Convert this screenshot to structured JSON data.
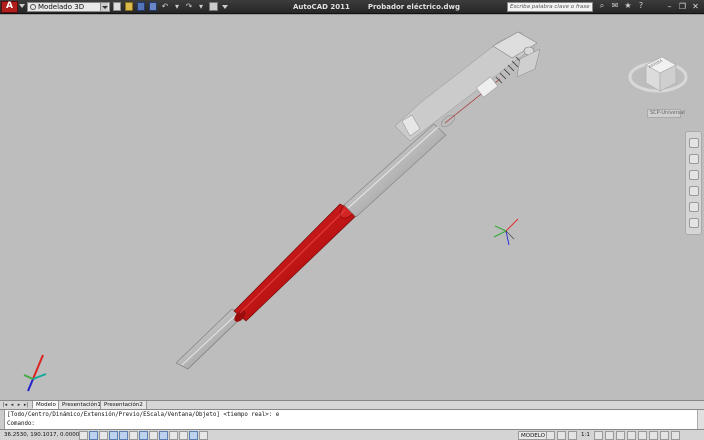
{
  "titlebar": {
    "app_button_label": "A",
    "workspace": "Modelado 3D",
    "app_name": "AutoCAD 2011",
    "document": "Probador eléctrico.dwg",
    "search_placeholder": "Escriba palabra clave o frase"
  },
  "viewcube": {
    "face_label": "ARRIBA",
    "wcs_menu": "SCP-Universal"
  },
  "tabs": [
    {
      "label": "Modelo",
      "active": true
    },
    {
      "label": "Presentación1",
      "active": false
    },
    {
      "label": "Presentación2",
      "active": false
    }
  ],
  "command": {
    "history": "[Todo/Centro/Dinámico/Extensión/Previo/EScala/Ventana/Objeto] <tiempo real>: e",
    "prompt": "Comando:"
  },
  "status": {
    "coordinates": "36.2530, 190.1017, 0.0000",
    "model_button": "MODELO",
    "scale": "1:1"
  },
  "colors": {
    "viewport_bg": "#bdbdbd",
    "handle_red": "#c41818",
    "accent_red": "#b01e1e"
  }
}
